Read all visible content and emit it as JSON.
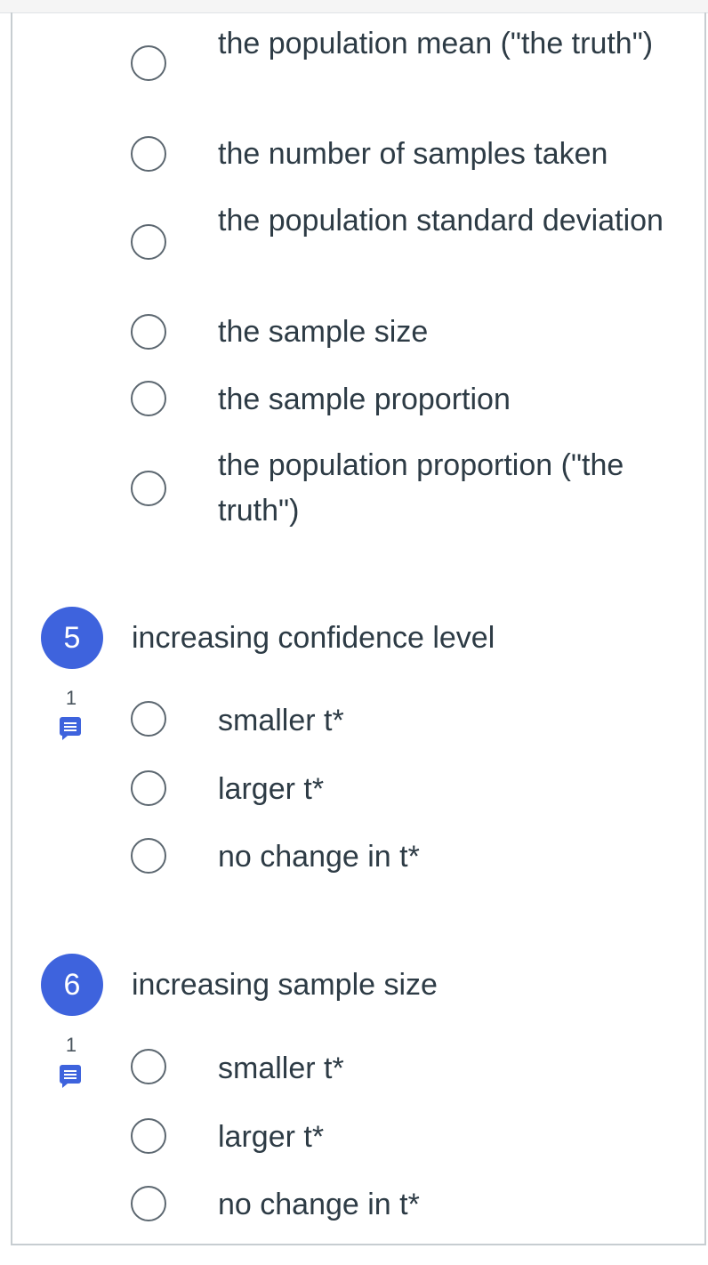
{
  "q4": {
    "options": [
      "the population mean (\"the truth\")",
      "the number of samples taken",
      "the population standard deviation",
      "the sample size",
      "the sample proportion",
      "the population proportion (\"the truth\")"
    ]
  },
  "q5": {
    "number": "5",
    "text": "increasing confidence level",
    "points": "1",
    "options": [
      "smaller t*",
      "larger t*",
      "no change in t*"
    ]
  },
  "q6": {
    "number": "6",
    "text": "increasing sample size",
    "points": "1",
    "options": [
      "smaller t*",
      "larger t*",
      "no change in t*"
    ]
  },
  "icons": {
    "comment": "comment-icon",
    "radio": "radio-button-unselected"
  },
  "colors": {
    "accent": "#3e63dd",
    "text": "#2d3b45",
    "border": "#5c6770"
  }
}
